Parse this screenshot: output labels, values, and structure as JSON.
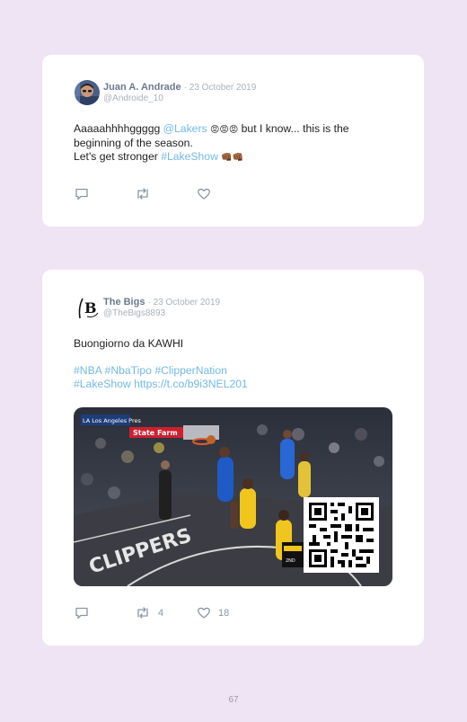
{
  "tweets": [
    {
      "author_name": "Juan A. Andrade",
      "date": "· 23 October 2019",
      "handle": "@Androide_10",
      "text": {
        "line1_a": "Aaaaahhhhggggg ",
        "line1_mention": "@Lakers",
        "line1_emoji": "😡😡😡",
        "line1_b": " but I know... this is the",
        "line2": "beginning of the season.",
        "line3_a": "Let's get stronger ",
        "line3_hashtag": "#LakeShow",
        "line3_emoji": "👊🏾👊🏾"
      },
      "actions": {
        "retweets": "",
        "likes": ""
      }
    },
    {
      "author_name": "The Bigs",
      "date": "· 23 October 2019",
      "handle": "@TheBigs8893",
      "avatar_logo": "B",
      "text": {
        "line1": "Buongiorno da KAWHI",
        "hashtags_line1": "#NBA #NbaTipo #ClipperNation",
        "hashtags_line2_a": "#LakeShow ",
        "link": "https://t.co/b9i3NEL201"
      },
      "media": {
        "arena_sign_1": "LA Los Angeles Pres",
        "arena_sign_2": "State Farm",
        "court_text": "CLIPPERS",
        "scoreboard": "2ND"
      },
      "actions": {
        "retweets": "4",
        "likes": "18"
      }
    }
  ],
  "page_number": "67",
  "colors": {
    "page_bg": "#efe4f3",
    "link": "#73b8e6",
    "name": "#6b7a8c",
    "muted": "#a8b2bc"
  }
}
